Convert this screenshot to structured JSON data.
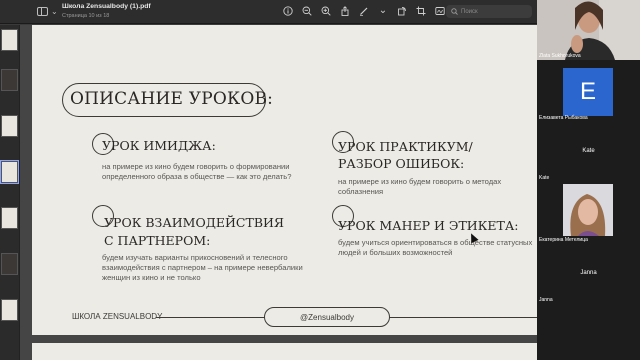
{
  "viewer": {
    "title": "Школа Zensualbody (1).pdf",
    "subtitle": "Страница 10 из 18",
    "search_placeholder": "Поиск",
    "tool_icons": [
      "info-icon",
      "zoom-out-icon",
      "zoom-in-icon",
      "share-icon",
      "pen-icon",
      "chevron-down-icon",
      "rotate-icon",
      "crop-icon",
      "sign-icon",
      "annotate-icon"
    ]
  },
  "slide": {
    "title": "ОПИСАНИЕ УРОКОВ:",
    "lessons": [
      {
        "heading": [
          "УРОК ИМИДЖА:"
        ],
        "text": "на примере из кино будем говорить о формировании определенного образа в обществе — как это делать?"
      },
      {
        "heading": [
          "УРОК ПРАКТИКУМ/",
          "РАЗБОР ОШИБОК:"
        ],
        "text": "на примере из кино будем говорить о методах соблазнения"
      },
      {
        "heading": [
          "УРОК ВЗАИМОДЕЙСТВИЯ",
          "С ПАРТНЕРОМ:"
        ],
        "text": "будем изучать варианты прикосновений и телесного взаимодействия с партнером – на примере невербалики женщин из кино и не только"
      },
      {
        "heading": [
          "УРОК МАНЕР И ЭТИКЕТА:"
        ],
        "text": "будем учиться ориентироваться в обществе статусных людей и больших возможностей"
      }
    ],
    "footer_left": "ШКОЛА ZENSUALBODY",
    "footer_handle": "@Zensualbody",
    "page_number": "10"
  },
  "call": {
    "participants": [
      {
        "name": "Zlata Sukhorukova",
        "kind": "video"
      },
      {
        "name": "Елизавета Рыбакова",
        "kind": "avatar",
        "initial": "E",
        "color": "#2b66cf"
      },
      {
        "name": "Kate",
        "kind": "name-only"
      },
      {
        "name": "Kate",
        "kind": "label"
      },
      {
        "name": "Екатерина Метелица",
        "kind": "video"
      },
      {
        "name": "Janna",
        "kind": "name-only"
      },
      {
        "name": "Janna",
        "kind": "label"
      }
    ]
  }
}
